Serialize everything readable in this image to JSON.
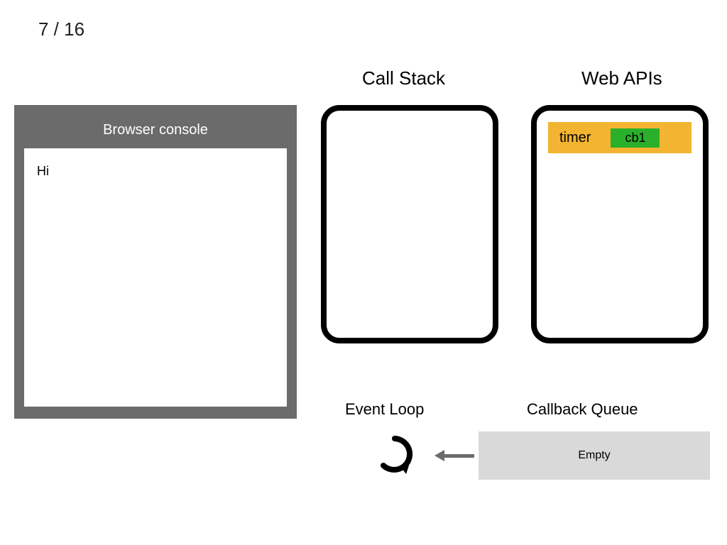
{
  "slide": {
    "current": 7,
    "total": 16,
    "display": "7 / 16"
  },
  "console": {
    "title": "Browser console",
    "lines": [
      "Hi"
    ]
  },
  "callstack": {
    "title": "Call Stack",
    "frames": []
  },
  "webapis": {
    "title": "Web APIs",
    "entries": [
      {
        "label": "timer",
        "callback": "cb1"
      }
    ]
  },
  "eventloop": {
    "title": "Event Loop"
  },
  "callbackqueue": {
    "title": "Callback Queue",
    "state": "Empty",
    "items": []
  }
}
